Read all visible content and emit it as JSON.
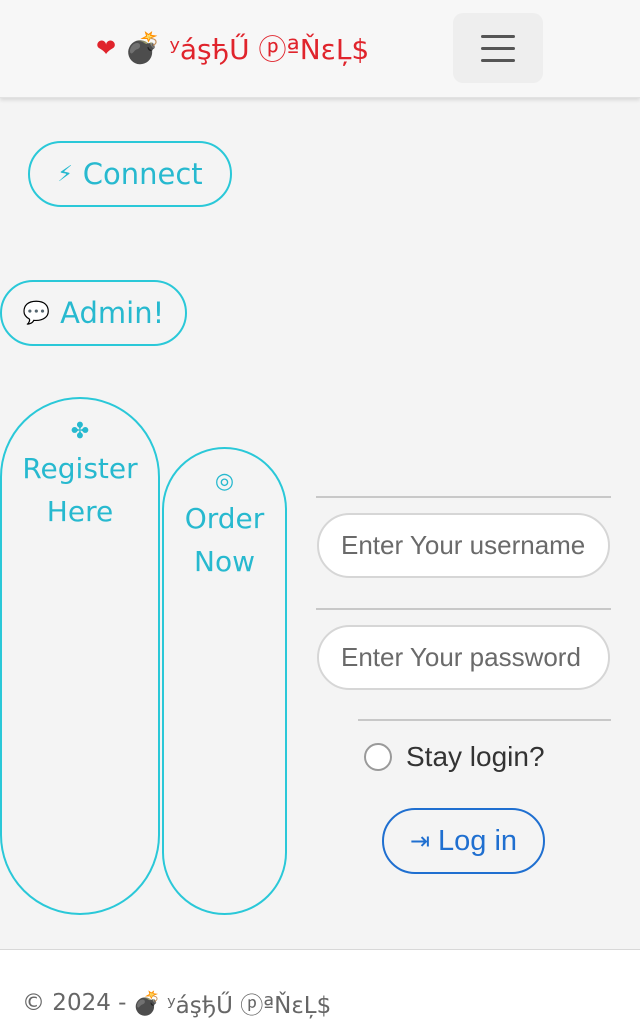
{
  "navbar": {
    "brand_heart": "❤",
    "brand_bomb": "💣",
    "brand_text": "ʸáşђŰ ⓟªŇɛĻ$",
    "toggler_icon": "hamburger-menu-icon"
  },
  "buttons": {
    "connect_icon": "⚡",
    "connect_label": "Connect",
    "admin_icon": "💬",
    "admin_label": "Admin!",
    "register_icon": "✤",
    "register_label": "Register Here",
    "order_icon": "◎",
    "order_label": "Order Now"
  },
  "login_form": {
    "username_placeholder": "Enter Your username",
    "password_placeholder": "Enter Your password",
    "stay_login_label": "Stay login?",
    "login_icon": "⇥",
    "login_label": "Log in"
  },
  "footer": {
    "copyright": "© 2024 -",
    "bomb": "💣",
    "brand_text": "ʸáşђŰ ⓟªŇɛĻ$"
  },
  "colors": {
    "accent_cyan": "#2ac8d8",
    "brand_red": "#e0242c",
    "login_blue": "#1f6fd0"
  }
}
